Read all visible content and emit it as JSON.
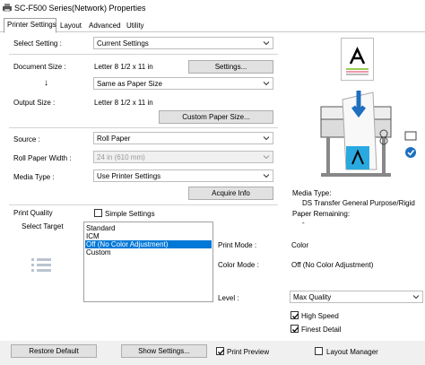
{
  "window": {
    "title": "SC-F500 Series(Network) Properties"
  },
  "tabs": [
    "Printer Settings",
    "Layout",
    "Advanced",
    "Utility"
  ],
  "select_setting": {
    "label": "Select Setting :",
    "value": "Current Settings"
  },
  "document_size": {
    "label": "Document Size :",
    "value": "Letter 8 1/2 x 11 in",
    "button": "Settings..."
  },
  "down_arrow": "↓",
  "output_combo": {
    "value": "Same as Paper Size"
  },
  "output_size": {
    "label": "Output Size :",
    "value": "Letter 8 1/2 x 11 in",
    "button": "Custom Paper Size..."
  },
  "source": {
    "label": "Source :",
    "value": "Roll Paper"
  },
  "roll_width": {
    "label": "Roll Paper Width :",
    "value": "24 in (610 mm)"
  },
  "media_type": {
    "label": "Media Type :",
    "value": "Use Printer Settings",
    "button": "Acquire Info"
  },
  "media_info": {
    "media_type_label": "Media Type:",
    "media_type_value": "DS Transfer General Purpose/Rigid",
    "remaining_label": "Paper Remaining:",
    "remaining_value": "-"
  },
  "print_quality": {
    "label": "Print Quality",
    "simple_settings": "Simple Settings",
    "simple_checked": false,
    "select_target_label": "Select Target",
    "targets": [
      "Standard",
      "ICM",
      "Off (No Color Adjustment)",
      "Custom"
    ],
    "selected_target": "Off (No Color Adjustment)"
  },
  "print_mode": {
    "label": "Print Mode :",
    "value": "Color"
  },
  "color_mode": {
    "label": "Color Mode :",
    "value": "Off (No Color Adjustment)"
  },
  "level": {
    "label": "Level :",
    "value": "Max Quality"
  },
  "high_speed": {
    "label": "High Speed",
    "checked": true
  },
  "finest_detail": {
    "label": "Finest Detail",
    "checked": true
  },
  "bottom": {
    "restore_default": "Restore Default",
    "show_settings": "Show Settings...",
    "print_preview": "Print Preview",
    "print_preview_checked": true,
    "layout_manager": "Layout Manager",
    "layout_manager_checked": false
  },
  "colors": {
    "selection": "#0078d7",
    "button_face": "#e1e1e1",
    "border": "#adadad",
    "printer_accent": "#29a9e0"
  }
}
